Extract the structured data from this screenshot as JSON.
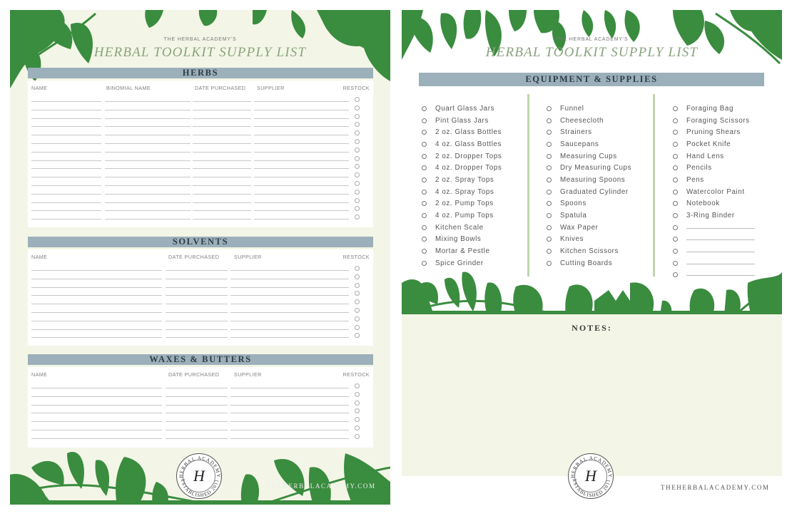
{
  "left_page": {
    "kicker": "THE HERBAL ACADEMY'S",
    "title": "HERBAL TOOLKIT SUPPLY LIST",
    "sections": {
      "herbs": {
        "heading": "HERBS",
        "columns": [
          "NAME",
          "BINOMIAL NAME",
          "DATE PURCHASED",
          "SUPPLIER",
          "RESTOCK"
        ],
        "row_count": 15
      },
      "solvents": {
        "heading": "SOLVENTS",
        "columns": [
          "NAME",
          "DATE PURCHASED",
          "SUPPLIER",
          "RESTOCK"
        ],
        "row_count": 9
      },
      "waxes": {
        "heading": "WAXES & BUTTERS",
        "columns": [
          "NAME",
          "DATE PURCHASED",
          "SUPPLIER",
          "RESTOCK"
        ],
        "row_count": 7
      }
    },
    "seal": {
      "letter": "H",
      "ring_top": "HERBAL ACADEMY",
      "ring_bottom": "ESTABLISHED 2011"
    },
    "website": "THEHERBALACADEMY.COM"
  },
  "right_page": {
    "kicker": "THE HERBAL ACADEMY'S",
    "title": "HERBAL TOOLKIT SUPPLY LIST",
    "section_heading": "EQUIPMENT & SUPPLIES",
    "columns": [
      [
        "Quart Glass Jars",
        "Pint Glass Jars",
        "2 oz. Glass Bottles",
        "4 oz. Glass Bottles",
        "2 oz. Dropper Tops",
        "4 oz. Dropper Tops",
        "2 oz. Spray Tops",
        "4 oz. Spray Tops",
        "2 oz. Pump Tops",
        "4 oz. Pump Tops",
        "Kitchen Scale",
        "Mixing Bowls",
        "Mortar & Pestle",
        "Spice Grinder"
      ],
      [
        "Funnel",
        "Cheesecloth",
        "Strainers",
        "Saucepans",
        "Measuring Cups",
        "Dry Measuring Cups",
        "Measuring Spoons",
        "Graduated Cylinder",
        "Spoons",
        "Spatula",
        "Wax Paper",
        "Knives",
        "Kitchen Scissors",
        "Cutting Boards"
      ],
      [
        "Foraging Bag",
        "Foraging Scissors",
        "Pruning Shears",
        "Pocket Knife",
        "Hand Lens",
        "Pencils",
        "Pens",
        "Watercolor Paint",
        "Notebook",
        "3-Ring Binder"
      ]
    ],
    "blank_lines_in_last_column": 5,
    "notes_label": "NOTES:",
    "seal": {
      "letter": "H",
      "ring_top": "HERBAL ACADEMY",
      "ring_bottom": "ESTABLISHED 2011"
    },
    "website": "THEHERBALACADEMY.COM"
  },
  "colors": {
    "leaf_green": "#3a8c3f",
    "cream": "#f3f6e6",
    "section_bar": "#9cb0bb",
    "title_green": "#8aa37e",
    "divider_green": "#bfd6ad"
  }
}
